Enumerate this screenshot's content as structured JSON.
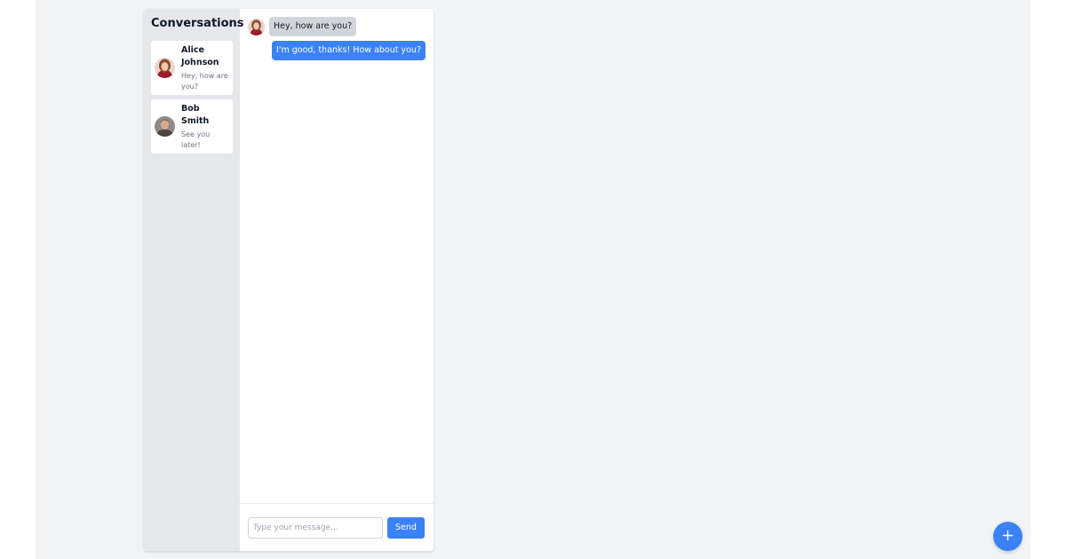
{
  "sidebar": {
    "title": "Conversations",
    "conversations": [
      {
        "name": "Alice Johnson",
        "preview": "Hey, how are you?",
        "avatar": "alice-avatar"
      },
      {
        "name": "Bob Smith",
        "preview": "See you later!",
        "avatar": "bob-avatar"
      }
    ]
  },
  "chat": {
    "messages": [
      {
        "direction": "incoming",
        "text": "Hey, how are you?",
        "avatar": "alice-avatar"
      },
      {
        "direction": "outgoing",
        "text": "I'm good, thanks! How about you?"
      }
    ]
  },
  "composer": {
    "placeholder": "Type your message...",
    "value": "",
    "send_label": "Send"
  },
  "fab": {
    "icon": "plus-icon"
  },
  "colors": {
    "accent": "#3b82f6",
    "sidebar_bg": "#e5e7eb",
    "incoming_bubble": "#d1d5db",
    "page_bg": "#f2f3f5"
  }
}
